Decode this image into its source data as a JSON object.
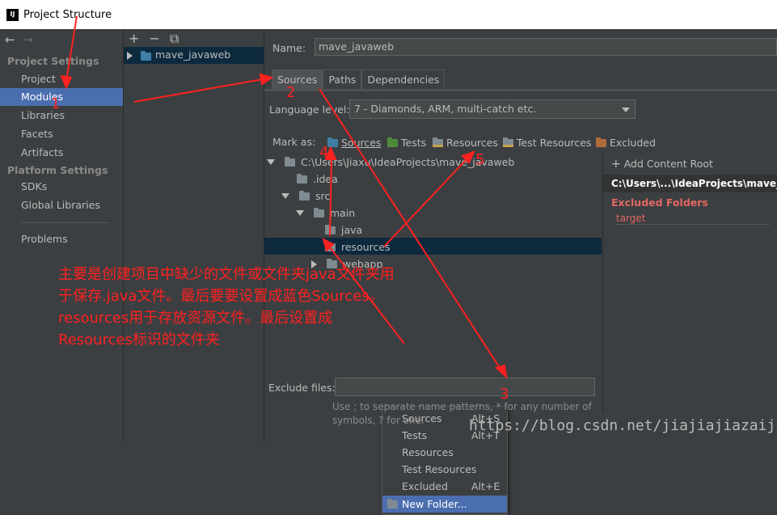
{
  "window": {
    "title": "Project Structure",
    "icon_text": "IJ"
  },
  "left_nav": {
    "project_settings_header": "Project Settings",
    "project_settings": [
      "Project",
      "Modules",
      "Libraries",
      "Facets",
      "Artifacts"
    ],
    "platform_settings_header": "Platform Settings",
    "platform_settings": [
      "SDKs",
      "Global Libraries"
    ],
    "problems": "Problems",
    "selected": "Modules"
  },
  "modules_tree": {
    "module_name": "mave_javaweb",
    "toolbar": [
      "+",
      "−",
      "⧉"
    ]
  },
  "name_field": {
    "label": "Name:",
    "value": "mave_javaweb"
  },
  "tabs": [
    "Sources",
    "Paths",
    "Dependencies"
  ],
  "language_level": {
    "label": "Language level:",
    "value": "7 - Diamonds, ARM, multi-catch etc."
  },
  "mark_as": {
    "label": "Mark as:",
    "options": [
      "Sources",
      "Tests",
      "Resources",
      "Test Resources",
      "Excluded"
    ]
  },
  "content_tree": {
    "root": "C:\\Users\\Jiaxu\\IdeaProjects\\mave_javaweb",
    "idea": ".idea",
    "src": "src",
    "main": "main",
    "java": "java",
    "resources": "resources",
    "webapp": "webapp"
  },
  "roots_panel": {
    "add_content_root": "Add Content Root",
    "root_path": "C:\\Users\\...\\IdeaProjects\\mave_javaweb",
    "excluded_title": "Excluded Folders",
    "excluded_item": "target"
  },
  "context_menu": {
    "items": [
      {
        "label": "Sources",
        "shortcut": "Alt+S"
      },
      {
        "label": "Tests",
        "shortcut": "Alt+T"
      },
      {
        "label": "Resources",
        "shortcut": ""
      },
      {
        "label": "Test Resources",
        "shortcut": ""
      },
      {
        "label": "Excluded",
        "shortcut": "Alt+E"
      },
      {
        "label": "New Folder...",
        "shortcut": ""
      }
    ]
  },
  "exclude_files": {
    "label": "Exclude files:",
    "hint_line1": "Use ; to separate name patterns, * for any number of",
    "hint_line2_pre": "symbols, ? for one.",
    "hint_sep": ";",
    "hint_star": "*",
    "hint_q": "?"
  },
  "annotation": {
    "text": "主要是创建项目中缺少的文件或文件夹java文件夹用于保存.java文件。最后要要设置成蓝色Sources。resources用于存放资源文件。最后设置成Resources标识的文件夹",
    "numbers": [
      "1",
      "2",
      "3",
      "4",
      "5"
    ],
    "color": "#ff2020"
  },
  "watermark": "https://blog.csdn.net/jiajiajiazaijia",
  "colors": {
    "selection": "#4b6eaf",
    "tree_selection": "#0d293e",
    "excluded": "#e36862"
  }
}
